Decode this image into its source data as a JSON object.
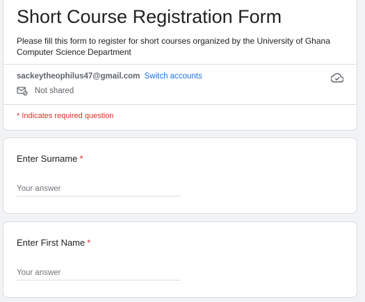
{
  "form": {
    "title": "Short Course Registration Form",
    "description": "Please fill this form to register for short courses organized by the University of Ghana Computer Science Department"
  },
  "account": {
    "email": "sackeytheophilus47@gmail.com",
    "switch_label": "Switch accounts",
    "shared_status": "Not shared",
    "cloud_icon": "cloud-check-icon",
    "mail_icon": "mail-not-shared-icon"
  },
  "required_note": "* Indicates required question",
  "questions": [
    {
      "label": "Enter Surname",
      "required_mark": "*",
      "value": "",
      "placeholder": "Your answer"
    },
    {
      "label": "Enter First Name",
      "required_mark": "*",
      "value": "",
      "placeholder": "Your answer"
    }
  ],
  "colors": {
    "background": "#f1f3f4",
    "card": "#ffffff",
    "border": "#dadce0",
    "required": "#d93025",
    "link": "#1a73e8",
    "muted_text": "#5f6368"
  }
}
